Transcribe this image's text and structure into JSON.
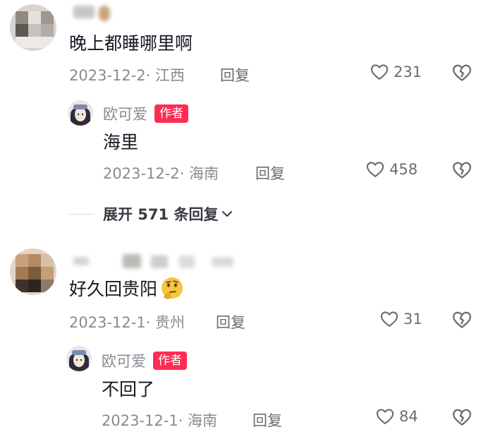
{
  "colors": {
    "badge": "#fe2c55",
    "meta": "#8a8b91",
    "text": "#161823"
  },
  "comments": [
    {
      "text": "晚上都睡哪里啊",
      "date": "2023-12-2",
      "location": "江西",
      "reply_label": "回复",
      "likes": "231",
      "replies": [
        {
          "author": "欧可爱",
          "badge": "作者",
          "text": "海里",
          "date": "2023-12-2",
          "location": "海南",
          "reply_label": "回复",
          "likes": "458"
        }
      ],
      "expand_label": "展开 571 条回复"
    },
    {
      "text": "好久回贵阳",
      "emoji": "🤔",
      "date": "2023-12-1",
      "location": "贵州",
      "reply_label": "回复",
      "likes": "31",
      "replies": [
        {
          "author": "欧可爱",
          "badge": "作者",
          "text": "不回了",
          "date": "2023-12-1",
          "location": "海南",
          "reply_label": "回复",
          "likes": "84"
        }
      ]
    }
  ],
  "icons": {
    "like": "heart-outline-icon",
    "dislike": "broken-heart-icon",
    "expand": "chevron-down-icon"
  }
}
